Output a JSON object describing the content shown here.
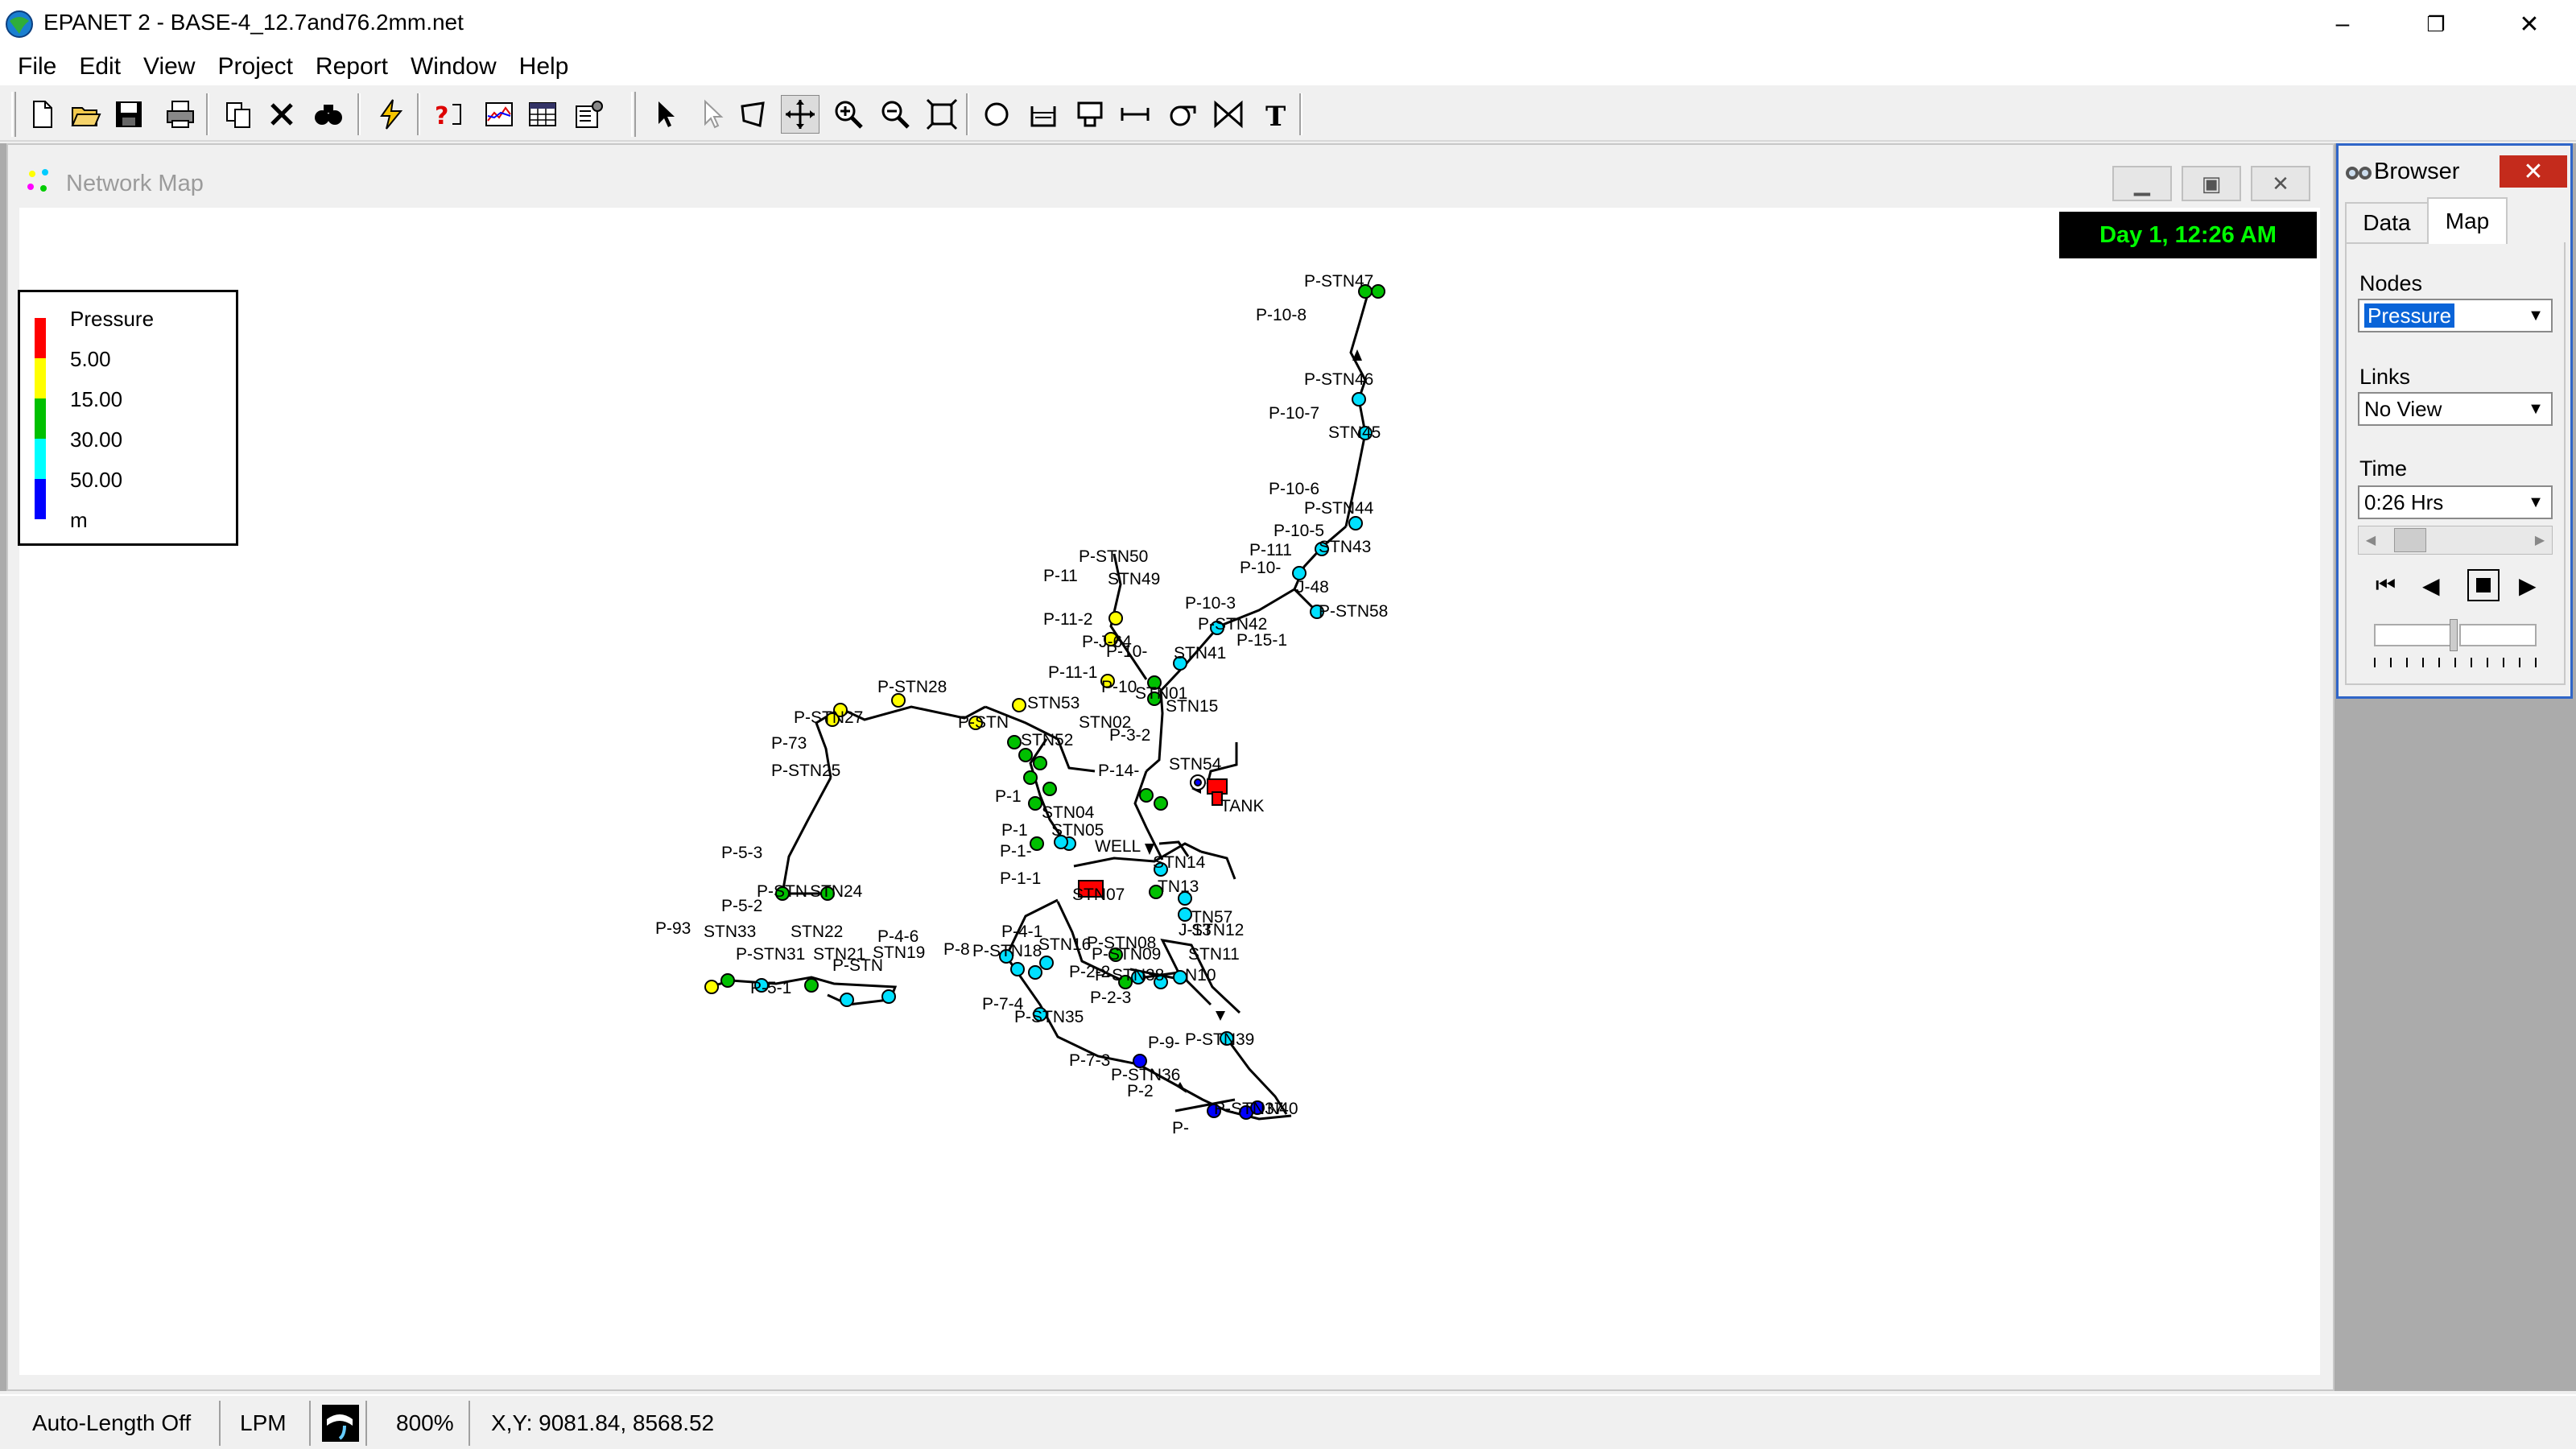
{
  "window": {
    "title": "EPANET 2 - BASE-4_12.7and76.2mm.net",
    "minimize_glyph": "–",
    "restore_glyph": "❐",
    "close_glyph": "✕"
  },
  "menu": [
    "File",
    "Edit",
    "View",
    "Project",
    "Report",
    "Window",
    "Help"
  ],
  "toolbar": {
    "icons": [
      "new-file-icon",
      "open-folder-icon",
      "save-icon",
      "print-icon",
      "copy-icon",
      "delete-icon",
      "find-icon",
      "run-analysis-icon",
      "query-icon",
      "graph-icon",
      "table-icon",
      "options-icon",
      "select-object-icon",
      "select-vertex-icon",
      "select-region-icon",
      "pan-icon",
      "zoom-in-icon",
      "zoom-out-icon",
      "full-extent-icon",
      "add-junction-icon",
      "add-reservoir-icon",
      "add-tank-icon",
      "add-pipe-icon",
      "add-pump-icon",
      "add-valve-icon",
      "add-label-icon"
    ]
  },
  "network_map": {
    "title": "Network Map",
    "clock": "Day 1, 12:26 AM",
    "legend": {
      "title": "Pressure",
      "values": [
        "5.00",
        "15.00",
        "30.00",
        "50.00"
      ],
      "unit": "m",
      "colors": [
        "#ff0000",
        "#ffff00",
        "#00c000",
        "#00ffff",
        "#0000ff"
      ]
    },
    "node_colors": {
      "red": "#ff0000",
      "yellow": "#ffff00",
      "green": "#00c000",
      "cyan": "#00e0ff",
      "blue": "#0000ff"
    },
    "labels": [
      "P-STN47",
      "P-10-8",
      "P-STN46",
      "P-10-7",
      "STN45",
      "P-10-6",
      "P-STN44",
      "P-10-5",
      "P-111",
      "STN43",
      "P-10-",
      "J-48",
      "P-STN58",
      "P-10-3",
      "P-STN42",
      "P-15-1",
      "P-STN50",
      "P-11",
      "STN49",
      "P-11-2",
      "P-J-64",
      "P-10-",
      "STN41",
      "P-11-1",
      "P-10",
      "STN01",
      "STN15",
      "P-STN28",
      "P-STN27",
      "STN53",
      "STN02",
      "P-STN",
      "STN52",
      "P-3-2",
      "P-73",
      "P-STN25",
      "P-14-",
      "STN54",
      "P-1",
      "STN04",
      "TANK",
      "P-1",
      "STN05",
      "WELL",
      "P-1-",
      "STN14",
      "P-1-1",
      "STN07",
      "TN13",
      "P-5-3",
      "P-STN",
      "STN24",
      "P-5-2",
      "STN22",
      "STN33",
      "P-93",
      "P-4-1",
      "TN57",
      "J-13",
      "STN12",
      "P-STN08",
      "P-4-6",
      "STN19",
      "P-8",
      "P-STN18",
      "STN16",
      "P-STN31",
      "STN21",
      "P-STN",
      "P-5-1",
      "P-STN09",
      "STN11",
      "P-2-2",
      "P-STN38",
      "N10",
      "P-7-4",
      "P-2-3",
      "P-STN35",
      "P-9-",
      "P-STN39",
      "P-7-3",
      "P-STN36",
      "P-2",
      "P-STN37",
      "N40",
      "P-"
    ]
  },
  "browser": {
    "title": "Browser",
    "close_glyph": "✕",
    "tabs": [
      "Data",
      "Map"
    ],
    "active_tab": "Map",
    "nodes_label": "Nodes",
    "nodes_value": "Pressure",
    "links_label": "Links",
    "links_value": "No View",
    "time_label": "Time",
    "time_value": "0:26 Hrs"
  },
  "status": {
    "auto_length": "Auto-Length Off",
    "flow_units": "LPM",
    "zoom": "800%",
    "coords": "X,Y: 9081.84, 8568.52"
  }
}
